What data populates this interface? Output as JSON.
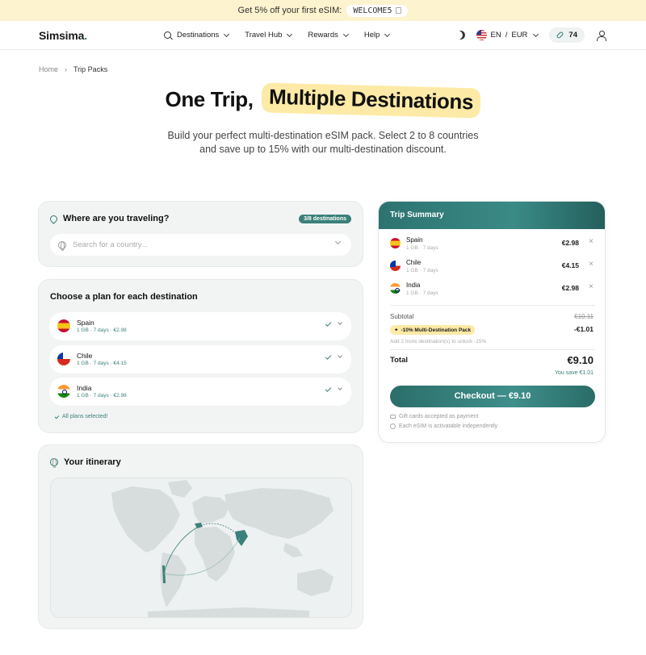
{
  "promo": {
    "text": "Get 5% off your first eSIM:",
    "code": "WELCOME5"
  },
  "header": {
    "logo": "Simsima",
    "nav": [
      "Destinations",
      "Travel Hub",
      "Rewards",
      "Help"
    ],
    "language": "EN",
    "separator": "/",
    "currency": "EUR",
    "points": "74"
  },
  "breadcrumb": {
    "home": "Home",
    "current": "Trip Packs"
  },
  "hero": {
    "title_plain": "One Trip,",
    "title_highlight": "Multiple Destinations",
    "subtitle": "Build your perfect multi-destination eSIM pack. Select 2 to 8 countries and save up to 15% with our multi-destination discount."
  },
  "where": {
    "title": "Where are you traveling?",
    "badge": "3/8 destinations",
    "placeholder": "Search for a country..."
  },
  "plans": {
    "title": "Choose a plan for each destination",
    "items": [
      {
        "name": "Spain",
        "meta": "1 GB · 7 days · €2.98",
        "flag": "es"
      },
      {
        "name": "Chile",
        "meta": "1 GB · 7 days · €4.15",
        "flag": "cl"
      },
      {
        "name": "India",
        "meta": "1 GB · 7 days · €2.98",
        "flag": "in"
      }
    ],
    "all_selected": "All plans selected!"
  },
  "itinerary": {
    "title": "Your itinerary"
  },
  "summary": {
    "title": "Trip Summary",
    "items": [
      {
        "name": "Spain",
        "meta": "1 GB · 7 days",
        "price": "€2.98"
      },
      {
        "name": "Chile",
        "meta": "1 GB · 7 days",
        "price": "€4.15"
      },
      {
        "name": "India",
        "meta": "1 GB · 7 days",
        "price": "€2.98"
      }
    ],
    "remove": "×",
    "subtotal_label": "Subtotal",
    "subtotal_value": "€10.11",
    "discount_label": "-10% Multi-Destination Pack",
    "discount_value": "-€1.01",
    "unlock_text": "Add 2 more destination(s) to unlock -15%",
    "total_label": "Total",
    "total_value": "€9.10",
    "save_text": "You save €1.01",
    "checkout": "Checkout — €9.10",
    "note_gift": "Gift cards accepted as payment",
    "note_activation": "Each eSIM is activatable independently"
  },
  "colors": {
    "accent": "#3b807a",
    "highlight": "#fdeaa6",
    "promo_bg": "#fdf3cf"
  }
}
